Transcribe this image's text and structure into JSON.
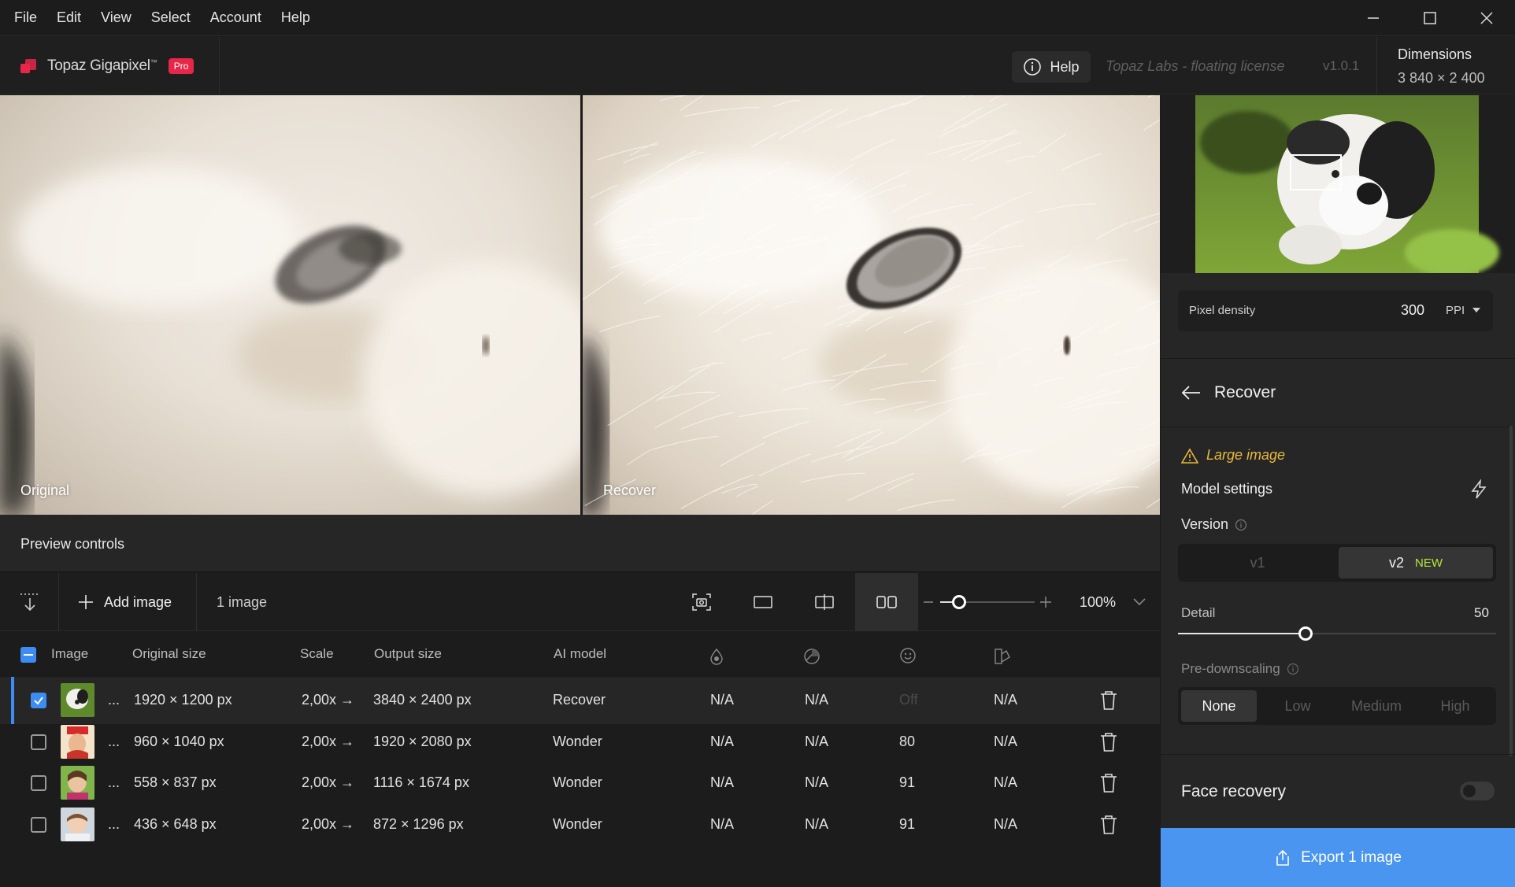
{
  "menu": [
    "File",
    "Edit",
    "View",
    "Select",
    "Account",
    "Help"
  ],
  "window_controls": {
    "minimize_icon": "minimize-icon",
    "maximize_icon": "maximize-icon",
    "close_icon": "close-icon"
  },
  "header": {
    "app_name": "Topaz Gigapixel",
    "app_name_mark": "™",
    "badge": "Pro",
    "help_label": "Help",
    "license": "Topaz Labs - floating license",
    "version": "v1.0.1",
    "dimensions_title": "Dimensions",
    "dimensions_value": "3 840 × 2 400"
  },
  "preview": {
    "original_label": "Original",
    "recover_label": "Recover",
    "controls_label": "Preview controls"
  },
  "toolbar": {
    "add_image_label": "Add image",
    "image_count": "1 image",
    "zoom": "100%",
    "zoom_fraction": 0.2
  },
  "table": {
    "headers": [
      "Image",
      "Original size",
      "Scale",
      "Output size",
      "AI model"
    ],
    "rows": [
      {
        "selected": true,
        "ellipsis": "...",
        "original": "1920 × 1200 px",
        "scale": "2,00x →",
        "output": "3840 × 2400 px",
        "model": "Recover",
        "c1": "N/A",
        "c2": "N/A",
        "c3": "Off",
        "c4": "N/A",
        "thumb": "dog"
      },
      {
        "selected": false,
        "ellipsis": "...",
        "original": "960 × 1040 px",
        "scale": "2,00x →",
        "output": "1920 × 2080 px",
        "model": "Wonder",
        "c1": "N/A",
        "c2": "N/A",
        "c3": "80",
        "c4": "N/A",
        "thumb": "child-red"
      },
      {
        "selected": false,
        "ellipsis": "...",
        "original": "558 × 837 px",
        "scale": "2,00x →",
        "output": "1116 × 1674 px",
        "model": "Wonder",
        "c1": "N/A",
        "c2": "N/A",
        "c3": "91",
        "c4": "N/A",
        "thumb": "child-green"
      },
      {
        "selected": false,
        "ellipsis": "...",
        "original": "436 × 648 px",
        "scale": "2,00x →",
        "output": "872 × 1296 px",
        "model": "Wonder",
        "c1": "N/A",
        "c2": "N/A",
        "c3": "91",
        "c4": "N/A",
        "thumb": "child-white"
      }
    ]
  },
  "panel": {
    "pixel_density_label": "Pixel density",
    "pixel_density_value": "300",
    "pixel_density_unit": "PPI",
    "title": "Recover",
    "warning": "Large image",
    "model_settings": "Model settings",
    "version_label": "Version",
    "version_options": [
      "v1",
      "v2"
    ],
    "version_new": "NEW",
    "detail_label": "Detail",
    "detail_value": "50",
    "detail_fraction": 0.5,
    "predownscaling_label": "Pre-downscaling",
    "predownscaling_options": [
      "None",
      "Low",
      "Medium",
      "High"
    ],
    "face_recovery_label": "Face recovery",
    "face_recovery_on": false,
    "export_label": "Export 1 image"
  },
  "colors": {
    "accent": "#4a95f0",
    "brand": "#e8264a",
    "warning": "#e8b93a",
    "new_badge": "#b6e83a"
  }
}
